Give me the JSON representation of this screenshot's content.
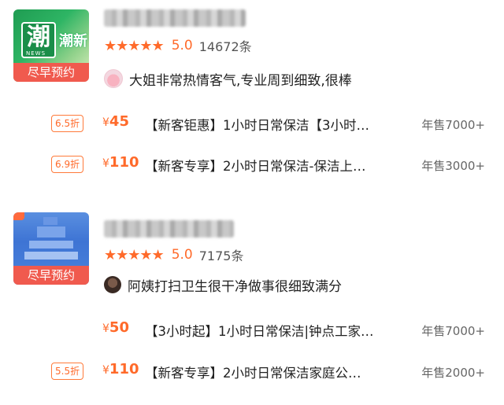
{
  "stores": [
    {
      "brand_text": "潮新",
      "logo_char": "潮",
      "logo_sub": "NEWS",
      "booking_label": "尽早预约",
      "stars": "★★★★★",
      "score": "5.0",
      "reviews": "14672条",
      "comment": "大姐非常热情客气,专业周到细致,很棒",
      "deals": [
        {
          "discount": "6.5折",
          "currency": "¥",
          "price": "45",
          "title": "【新客钜惠】1小时日常保洁【3小时…",
          "sales": "年售7000+"
        },
        {
          "discount": "6.9折",
          "currency": "¥",
          "price": "110",
          "title": "【新客专享】2小时日常保洁-保洁上…",
          "sales": "年售3000+"
        }
      ]
    },
    {
      "booking_label": "尽早预约",
      "stars": "★★★★★",
      "score": "5.0",
      "reviews": "7175条",
      "comment": "阿姨打扫卫生很干净做事很细致满分",
      "deals": [
        {
          "discount": "",
          "currency": "¥",
          "price": "50",
          "title": "【3小时起】1小时日常保洁|钟点工家…",
          "sales": "年售7000+"
        },
        {
          "discount": "5.5折",
          "currency": "¥",
          "price": "110",
          "title": "【新客专享】2小时日常保洁家庭公…",
          "sales": "年售2000+"
        }
      ]
    }
  ],
  "colors": {
    "accent": "#ff6a2a",
    "booking_bg": "#f05a4e",
    "muted": "#666666"
  },
  "icons": [
    "star-icon",
    "avatar-icon"
  ]
}
